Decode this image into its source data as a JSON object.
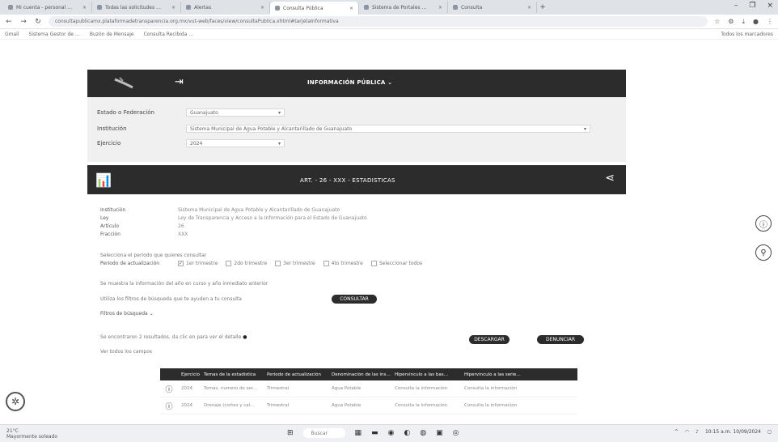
{
  "browser": {
    "tabs": [
      {
        "label": "Mi cuenta - personal …",
        "active": false
      },
      {
        "label": "Todas las solicitudes …",
        "active": false
      },
      {
        "label": "Alertas",
        "active": false
      },
      {
        "label": "Consulta Pública",
        "active": true
      },
      {
        "label": "Sistema de Portales …",
        "active": false
      },
      {
        "label": "Consulta",
        "active": false
      }
    ],
    "new_tab_icon": "+",
    "url": "consultapublicamx.plataformadetransparencia.org.mx/vut-web/faces/view/consultaPublica.xhtml#tarjetaInformativa",
    "bookmarks": [
      "Gmail",
      "Sistema Gestor de …",
      "Buzón de Mensaje",
      "Consulta Recibida …"
    ],
    "bookmarks_right": "Todos los marcadores"
  },
  "hero": {
    "login_icon": "⇥",
    "title": "INFORMACIÓN PÚBLICA ⌄"
  },
  "filters": {
    "estado_label": "Estado o Federación",
    "estado_value": "Guanajuato",
    "institucion_label": "Institución",
    "institucion_value": "Sistema Municipal de Agua Potable y Alcantarillado de Guanajuato",
    "ejercicio_label": "Ejercicio",
    "ejercicio_value": "2024"
  },
  "article": {
    "title": "ART. - 26 - XXX - ESTADISTICAS"
  },
  "info": {
    "institucion_k": "Institución",
    "institucion_v": "Sistema Municipal de Agua Potable y Alcantarillado de Guanajuato",
    "ley_k": "Ley",
    "ley_v": "Ley de Transparencia y Acceso a la Información para el Estado de Guanajuato",
    "articulo_k": "Artículo",
    "articulo_v": "26",
    "fraccion_k": "Fracción",
    "fraccion_v": "XXX"
  },
  "period": {
    "prompt": "Selecciona el periodo que quieres consultar",
    "label": "Periodo de actualización",
    "options": [
      "1er trimestre",
      "2do trimestre",
      "3er trimestre",
      "4to trimestre",
      "Seleccionar todos"
    ]
  },
  "texts": {
    "t1": "Se muestra la información del año en curso y año inmediato anterior",
    "t2": "Utiliza los filtros de búsqueda que te ayuden a tu consulta",
    "consultar": "CONSULTAR",
    "filtros": "Filtros de búsqueda ⌄",
    "t3": "Se encontraron 2 resultados, da clic en  para ver el detalle",
    "t4": "Ver todos los campos",
    "descargar": "DESCARGAR",
    "denunciar": "DENUNCIAR"
  },
  "table": {
    "headers": [
      "Ejercicio",
      "Temas de la estadística",
      "Periodo de actualización",
      "Denominación de las ins…",
      "Hipervínculo a las bas…",
      "Hipervínculo a las serie…"
    ],
    "rows": [
      [
        "2024",
        "Tomas, número de ser…",
        "Trimestral",
        "Agua Potable",
        "Consulta la información",
        "Consulta la información"
      ],
      [
        "2024",
        "Drenaje (cortes y cal…",
        "Trimestral",
        "Agua Potable",
        "Consulta la información",
        "Consulta la información"
      ]
    ]
  },
  "taskbar": {
    "weather_temp": "21°C",
    "weather_desc": "Mayormente soleado",
    "search": "Buscar",
    "time": "10:15 a.m.",
    "date": "10/09/2024"
  }
}
